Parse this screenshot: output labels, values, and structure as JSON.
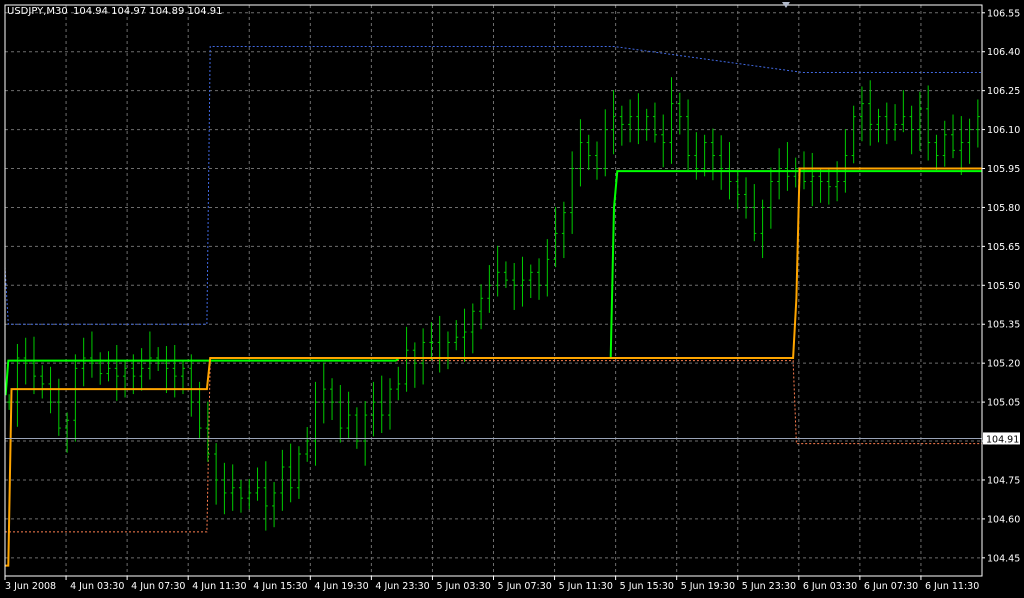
{
  "window": {
    "symbol_label": "USDJPY,M30",
    "ohlc_label": "104.94 104.97 104.89 104.91"
  },
  "colors": {
    "background": "#000000",
    "grid": "#6e6e6e",
    "axis": "#ffffff",
    "bars": "#00cc00",
    "upper_line": "#00ff00",
    "lower_line": "#ffa500",
    "upper_band": "#4169e1",
    "lower_band": "#ff7f50",
    "current_price_line": "#9aa4b8",
    "price_label_bg": "#ffffff",
    "price_label_text": "#000000"
  },
  "chart_data": {
    "type": "ohlc",
    "symbol": "USDJPY",
    "timeframe": "M30",
    "ylim": [
      104.38,
      106.58
    ],
    "y_ticks": [
      "106.55",
      "106.40",
      "106.25",
      "106.10",
      "105.95",
      "105.80",
      "105.65",
      "105.50",
      "105.35",
      "105.20",
      "105.05",
      "104.90",
      "104.75",
      "104.60",
      "104.45"
    ],
    "x_ticks": [
      "3 Jun 2008",
      "4 Jun 03:30",
      "4 Jun 07:30",
      "4 Jun 11:30",
      "4 Jun 15:30",
      "4 Jun 19:30",
      "4 Jun 23:30",
      "5 Jun 03:30",
      "5 Jun 07:30",
      "5 Jun 11:30",
      "5 Jun 15:30",
      "5 Jun 19:30",
      "5 Jun 23:30",
      "6 Jun 03:30",
      "6 Jun 07:30",
      "6 Jun 11:30"
    ],
    "grid": true,
    "current_price": "104.91",
    "close": [
      105.05,
      105.22,
      105.2,
      105.15,
      105.12,
      105.05,
      104.95,
      104.98,
      105.18,
      105.22,
      105.2,
      105.16,
      105.18,
      105.15,
      105.18,
      105.15,
      105.18,
      105.22,
      105.2,
      105.18,
      105.15,
      105.18,
      105.05,
      104.95,
      104.85,
      104.75,
      104.7,
      104.72,
      104.68,
      104.7,
      104.72,
      104.65,
      104.7,
      104.8,
      104.72,
      104.85,
      104.9,
      105.05,
      105.1,
      105.05,
      104.95,
      105.0,
      104.9,
      105.0,
      105.05,
      105.0,
      105.1,
      105.12,
      105.25,
      105.2,
      105.28,
      105.28,
      105.22,
      105.28,
      105.3,
      105.32,
      105.4,
      105.45,
      105.5,
      105.55,
      105.52,
      105.5,
      105.52,
      105.55,
      105.5,
      105.6,
      105.7,
      105.78,
      105.95,
      106.05,
      106.0,
      105.95,
      106.1,
      106.15,
      106.12,
      106.15,
      106.1,
      106.15,
      106.08,
      106.05,
      106.2,
      106.15,
      106.0,
      105.95,
      106.05,
      106.0,
      105.95,
      105.9,
      105.85,
      105.8,
      105.7,
      105.8,
      105.9,
      105.95,
      105.92,
      105.95,
      105.9,
      105.92,
      105.9,
      105.88,
      105.9,
      106.0,
      106.15,
      106.2,
      106.12,
      106.15,
      106.1,
      106.12,
      106.15,
      106.1,
      106.18,
      106.05,
      106.0,
      106.08,
      106.02,
      106.05,
      106.1,
      106.15
    ],
    "series": [
      {
        "name": "upper_line",
        "x": [
          0,
          0.2,
          1,
          62,
          62.4,
          120,
          121,
          122,
          123,
          186,
          187,
          188,
          189,
          194,
          196,
          242,
          243,
          245,
          246,
          253,
          258,
          300
        ],
        "y": [
          105.08,
          105.08,
          105.21,
          105.21,
          105.21,
          105.21,
          105.22,
          105.22,
          105.22,
          105.22,
          105.8,
          105.94,
          105.94,
          105.94,
          105.94,
          105.94,
          105.94,
          105.94,
          105.94,
          105.94,
          105.94,
          105.94
        ]
      },
      {
        "name": "lower_line",
        "x": [
          0,
          1,
          2,
          62,
          63,
          120,
          123,
          186,
          187,
          189,
          194,
          196,
          242,
          243,
          244,
          245,
          246,
          248,
          300
        ],
        "y": [
          104.42,
          104.42,
          105.1,
          105.1,
          105.22,
          105.22,
          105.22,
          105.22,
          105.22,
          105.22,
          105.22,
          105.22,
          105.22,
          105.45,
          105.95,
          105.95,
          105.95,
          105.95,
          105.95
        ]
      },
      {
        "name": "upper_band",
        "x": [
          0,
          1,
          2,
          62,
          63,
          123,
          124,
          186,
          187,
          245,
          246,
          300
        ],
        "y": [
          105.57,
          105.35,
          105.35,
          105.35,
          106.42,
          106.42,
          106.42,
          106.42,
          106.42,
          106.32,
          106.32,
          106.32
        ]
      },
      {
        "name": "lower_band",
        "x": [
          0,
          1,
          2,
          62,
          63,
          242,
          243,
          244,
          300
        ],
        "y": [
          104.55,
          104.55,
          104.55,
          104.55,
          105.21,
          105.21,
          104.89,
          104.89,
          104.89
        ]
      }
    ]
  }
}
